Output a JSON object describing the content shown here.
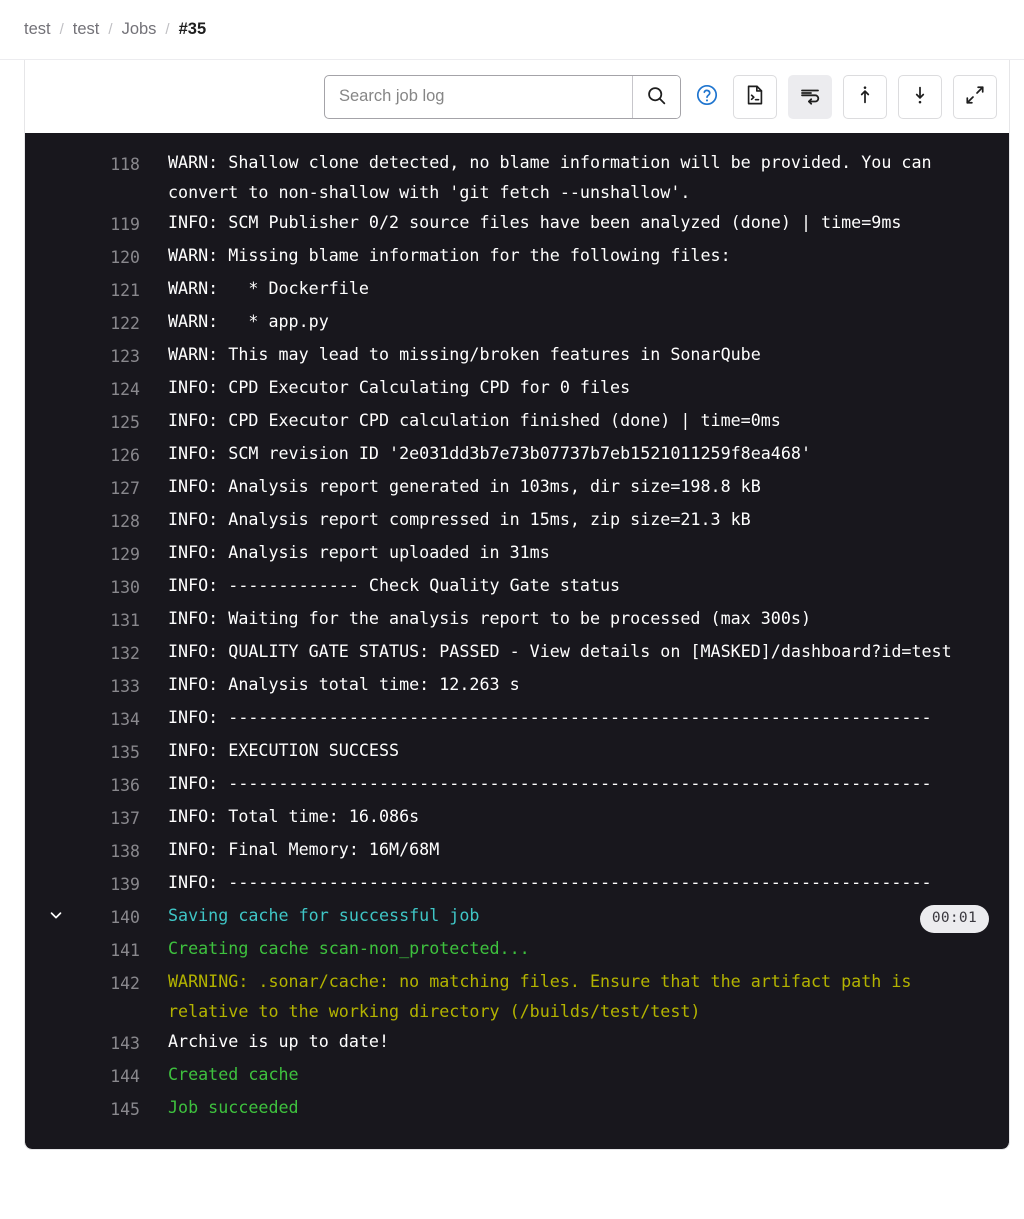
{
  "breadcrumb": {
    "items": [
      {
        "label": "test",
        "current": false
      },
      {
        "label": "test",
        "current": false
      },
      {
        "label": "Jobs",
        "current": false
      },
      {
        "label": "#35",
        "current": true
      }
    ],
    "separator": "/"
  },
  "toolbar": {
    "search": {
      "placeholder": "Search job log",
      "value": "",
      "button_icon": "search-icon"
    },
    "help_icon": "question-circle-icon",
    "buttons": [
      {
        "name": "raw-log-button",
        "icon": "file-terminal-icon",
        "active": false
      },
      {
        "name": "soft-wrap-button",
        "icon": "soft-wrap-icon",
        "active": true
      },
      {
        "name": "scroll-top-button",
        "icon": "scroll-up-icon",
        "active": false
      },
      {
        "name": "scroll-bottom-button",
        "icon": "scroll-down-icon",
        "active": false
      },
      {
        "name": "fullscreen-button",
        "icon": "expand-icon",
        "active": false
      }
    ]
  },
  "colors": {
    "log_background": "#18171d",
    "default_text": "#ffffff",
    "line_number": "#89888d",
    "green": "#3ec13e",
    "cyan": "#3fc6c6",
    "yellow": "#b3b300",
    "badge_background": "#ececef",
    "badge_text": "#3a383f"
  },
  "log": {
    "lines": [
      {
        "num": "118",
        "text": "WARN: Shallow clone detected, no blame information will be provided. You can convert to non-shallow with 'git fetch --unshallow'.",
        "color": "white",
        "collapsible": false
      },
      {
        "num": "119",
        "text": "INFO: SCM Publisher 0/2 source files have been analyzed (done) | time=9ms",
        "color": "white",
        "collapsible": false
      },
      {
        "num": "120",
        "text": "WARN: Missing blame information for the following files:",
        "color": "white",
        "collapsible": false
      },
      {
        "num": "121",
        "text": "WARN:   * Dockerfile",
        "color": "white",
        "collapsible": false
      },
      {
        "num": "122",
        "text": "WARN:   * app.py",
        "color": "white",
        "collapsible": false
      },
      {
        "num": "123",
        "text": "WARN: This may lead to missing/broken features in SonarQube",
        "color": "white",
        "collapsible": false
      },
      {
        "num": "124",
        "text": "INFO: CPD Executor Calculating CPD for 0 files",
        "color": "white",
        "collapsible": false
      },
      {
        "num": "125",
        "text": "INFO: CPD Executor CPD calculation finished (done) | time=0ms",
        "color": "white",
        "collapsible": false
      },
      {
        "num": "126",
        "text": "INFO: SCM revision ID '2e031dd3b7e73b07737b7eb1521011259f8ea468'",
        "color": "white",
        "collapsible": false
      },
      {
        "num": "127",
        "text": "INFO: Analysis report generated in 103ms, dir size=198.8 kB",
        "color": "white",
        "collapsible": false
      },
      {
        "num": "128",
        "text": "INFO: Analysis report compressed in 15ms, zip size=21.3 kB",
        "color": "white",
        "collapsible": false
      },
      {
        "num": "129",
        "text": "INFO: Analysis report uploaded in 31ms",
        "color": "white",
        "collapsible": false
      },
      {
        "num": "130",
        "text": "INFO: ------------- Check Quality Gate status",
        "color": "white",
        "collapsible": false
      },
      {
        "num": "131",
        "text": "INFO: Waiting for the analysis report to be processed (max 300s)",
        "color": "white",
        "collapsible": false
      },
      {
        "num": "132",
        "text": "INFO: QUALITY GATE STATUS: PASSED - View details on [MASKED]/dashboard?id=test",
        "color": "white",
        "collapsible": false
      },
      {
        "num": "133",
        "text": "INFO: Analysis total time: 12.263 s",
        "color": "white",
        "collapsible": false
      },
      {
        "num": "134",
        "text": "INFO: ----------------------------------------------------------------------",
        "color": "white",
        "collapsible": false
      },
      {
        "num": "135",
        "text": "INFO: EXECUTION SUCCESS",
        "color": "white",
        "collapsible": false
      },
      {
        "num": "136",
        "text": "INFO: ----------------------------------------------------------------------",
        "color": "white",
        "collapsible": false
      },
      {
        "num": "137",
        "text": "INFO: Total time: 16.086s",
        "color": "white",
        "collapsible": false
      },
      {
        "num": "138",
        "text": "INFO: Final Memory: 16M/68M",
        "color": "white",
        "collapsible": false
      },
      {
        "num": "139",
        "text": "INFO: ----------------------------------------------------------------------",
        "color": "white",
        "collapsible": false
      },
      {
        "num": "140",
        "text": "Saving cache for successful job",
        "color": "cyan",
        "collapsible": true,
        "duration": "00:01"
      },
      {
        "num": "141",
        "text": "Creating cache scan-non_protected...",
        "color": "green",
        "collapsible": false
      },
      {
        "num": "142",
        "text": "WARNING: .sonar/cache: no matching files. Ensure that the artifact path is relative to the working directory (/builds/test/test)",
        "color": "yellow",
        "collapsible": false
      },
      {
        "num": "143",
        "text": "Archive is up to date!",
        "color": "white",
        "collapsible": false
      },
      {
        "num": "144",
        "text": "Created cache",
        "color": "green",
        "collapsible": false
      },
      {
        "num": "145",
        "text": "Job succeeded",
        "color": "green",
        "collapsible": false
      }
    ]
  }
}
